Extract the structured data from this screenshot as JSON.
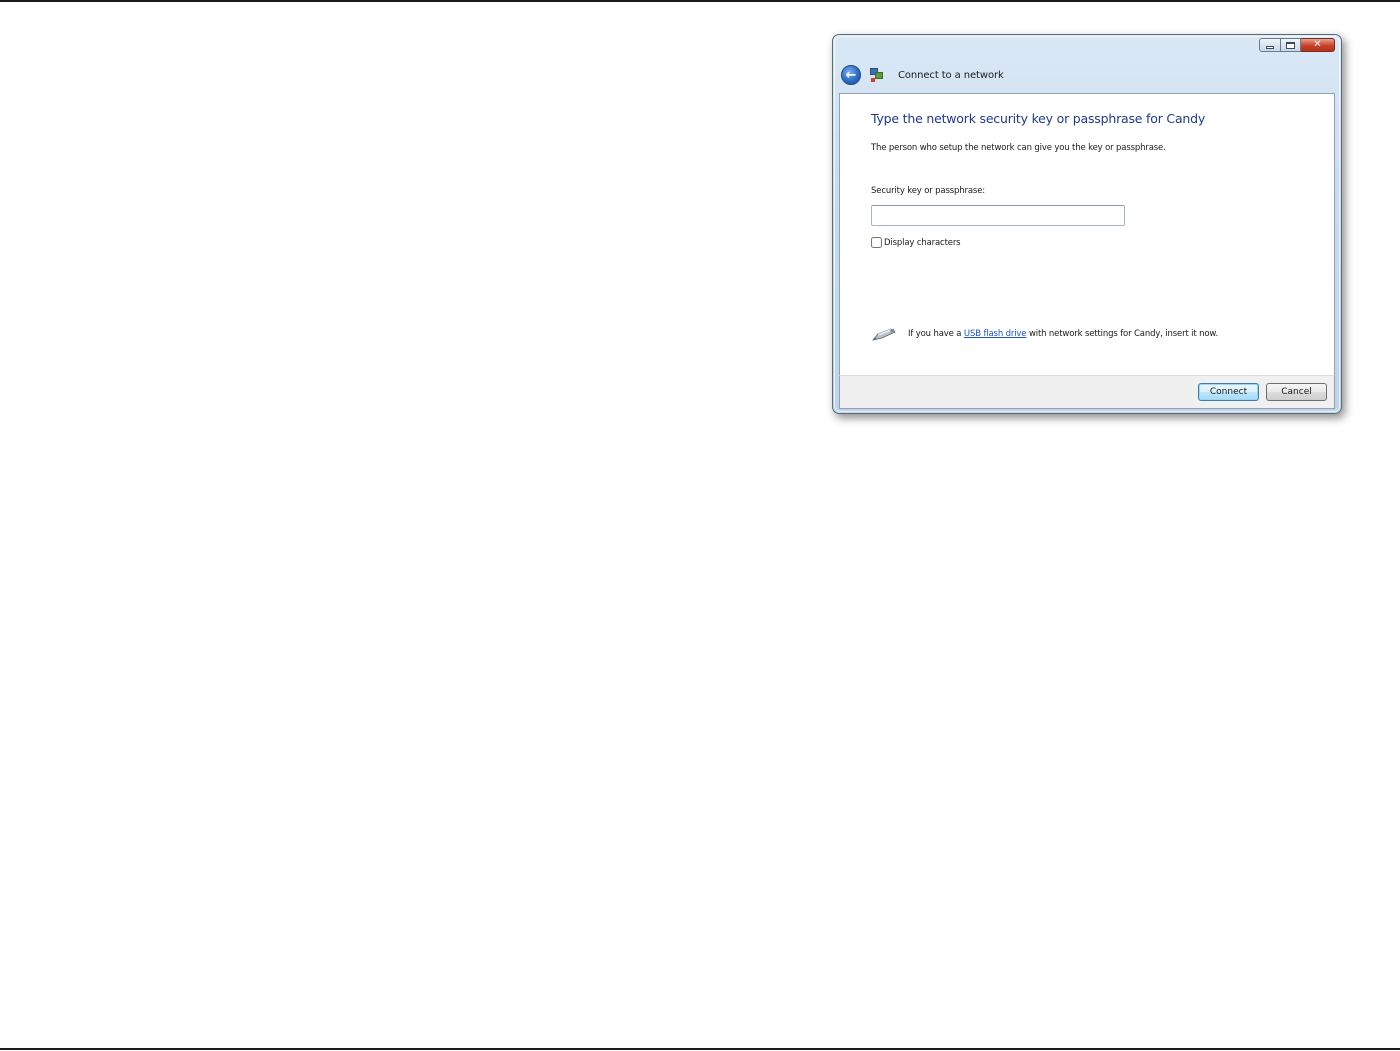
{
  "window": {
    "title": "Connect to a network",
    "accent_color": "#1e3a8c",
    "link_color": "#1a55c8"
  },
  "caption_buttons": {
    "minimize_icon": "minimize-icon",
    "maximize_icon": "maximize-icon",
    "close_icon": "close-icon",
    "close_glyph": "✕"
  },
  "nav": {
    "back_icon": "back-arrow-icon",
    "back_glyph": "←",
    "app_icon": "network-icon"
  },
  "main": {
    "heading": "Type the network security key or passphrase for Candy",
    "subtext": "The person who setup the network can give you the key or passphrase.",
    "key_label": "Security key or passphrase:",
    "key_value": "",
    "display_characters_label": "Display characters",
    "display_characters_checked": false
  },
  "usb": {
    "icon": "usb-drive-icon",
    "text_before": "If you have a ",
    "link_text": "USB flash drive",
    "text_after": " with network settings for Candy, insert it now."
  },
  "footer": {
    "connect_label": "Connect",
    "cancel_label": "Cancel"
  }
}
